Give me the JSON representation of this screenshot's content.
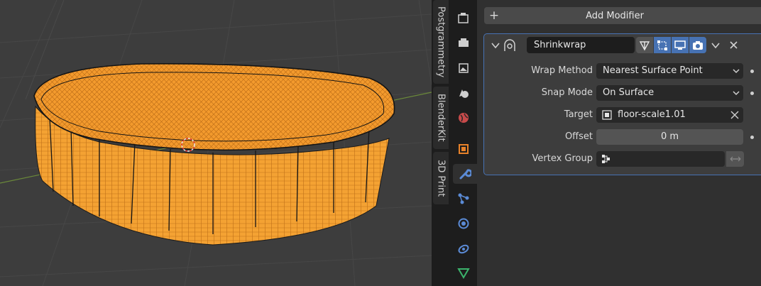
{
  "sidebar_tabs": [
    "Postgrammetry",
    "BlenderKit",
    "3D Print"
  ],
  "properties": {
    "add_modifier_label": "Add Modifier",
    "modifier": {
      "name": "Shrinkwrap",
      "wrap_method_label": "Wrap Method",
      "wrap_method_value": "Nearest Surface Point",
      "snap_mode_label": "Snap Mode",
      "snap_mode_value": "On Surface",
      "target_label": "Target",
      "target_value": "floor-scale1.01",
      "offset_label": "Offset",
      "offset_value": "0 m",
      "vertex_group_label": "Vertex Group",
      "vertex_group_value": ""
    }
  },
  "colors": {
    "accent": "#4772b3",
    "mesh_orange": "#f0962a",
    "modifier_blue": "#5b8bd6"
  },
  "icons": [
    "tool-icon",
    "render-icon",
    "output-icon",
    "view-layer-icon",
    "scene-icon",
    "world-icon",
    "object-icon",
    "modifier-wrench-icon",
    "particles-icon",
    "physics-icon",
    "constraints-icon",
    "data-icon"
  ]
}
